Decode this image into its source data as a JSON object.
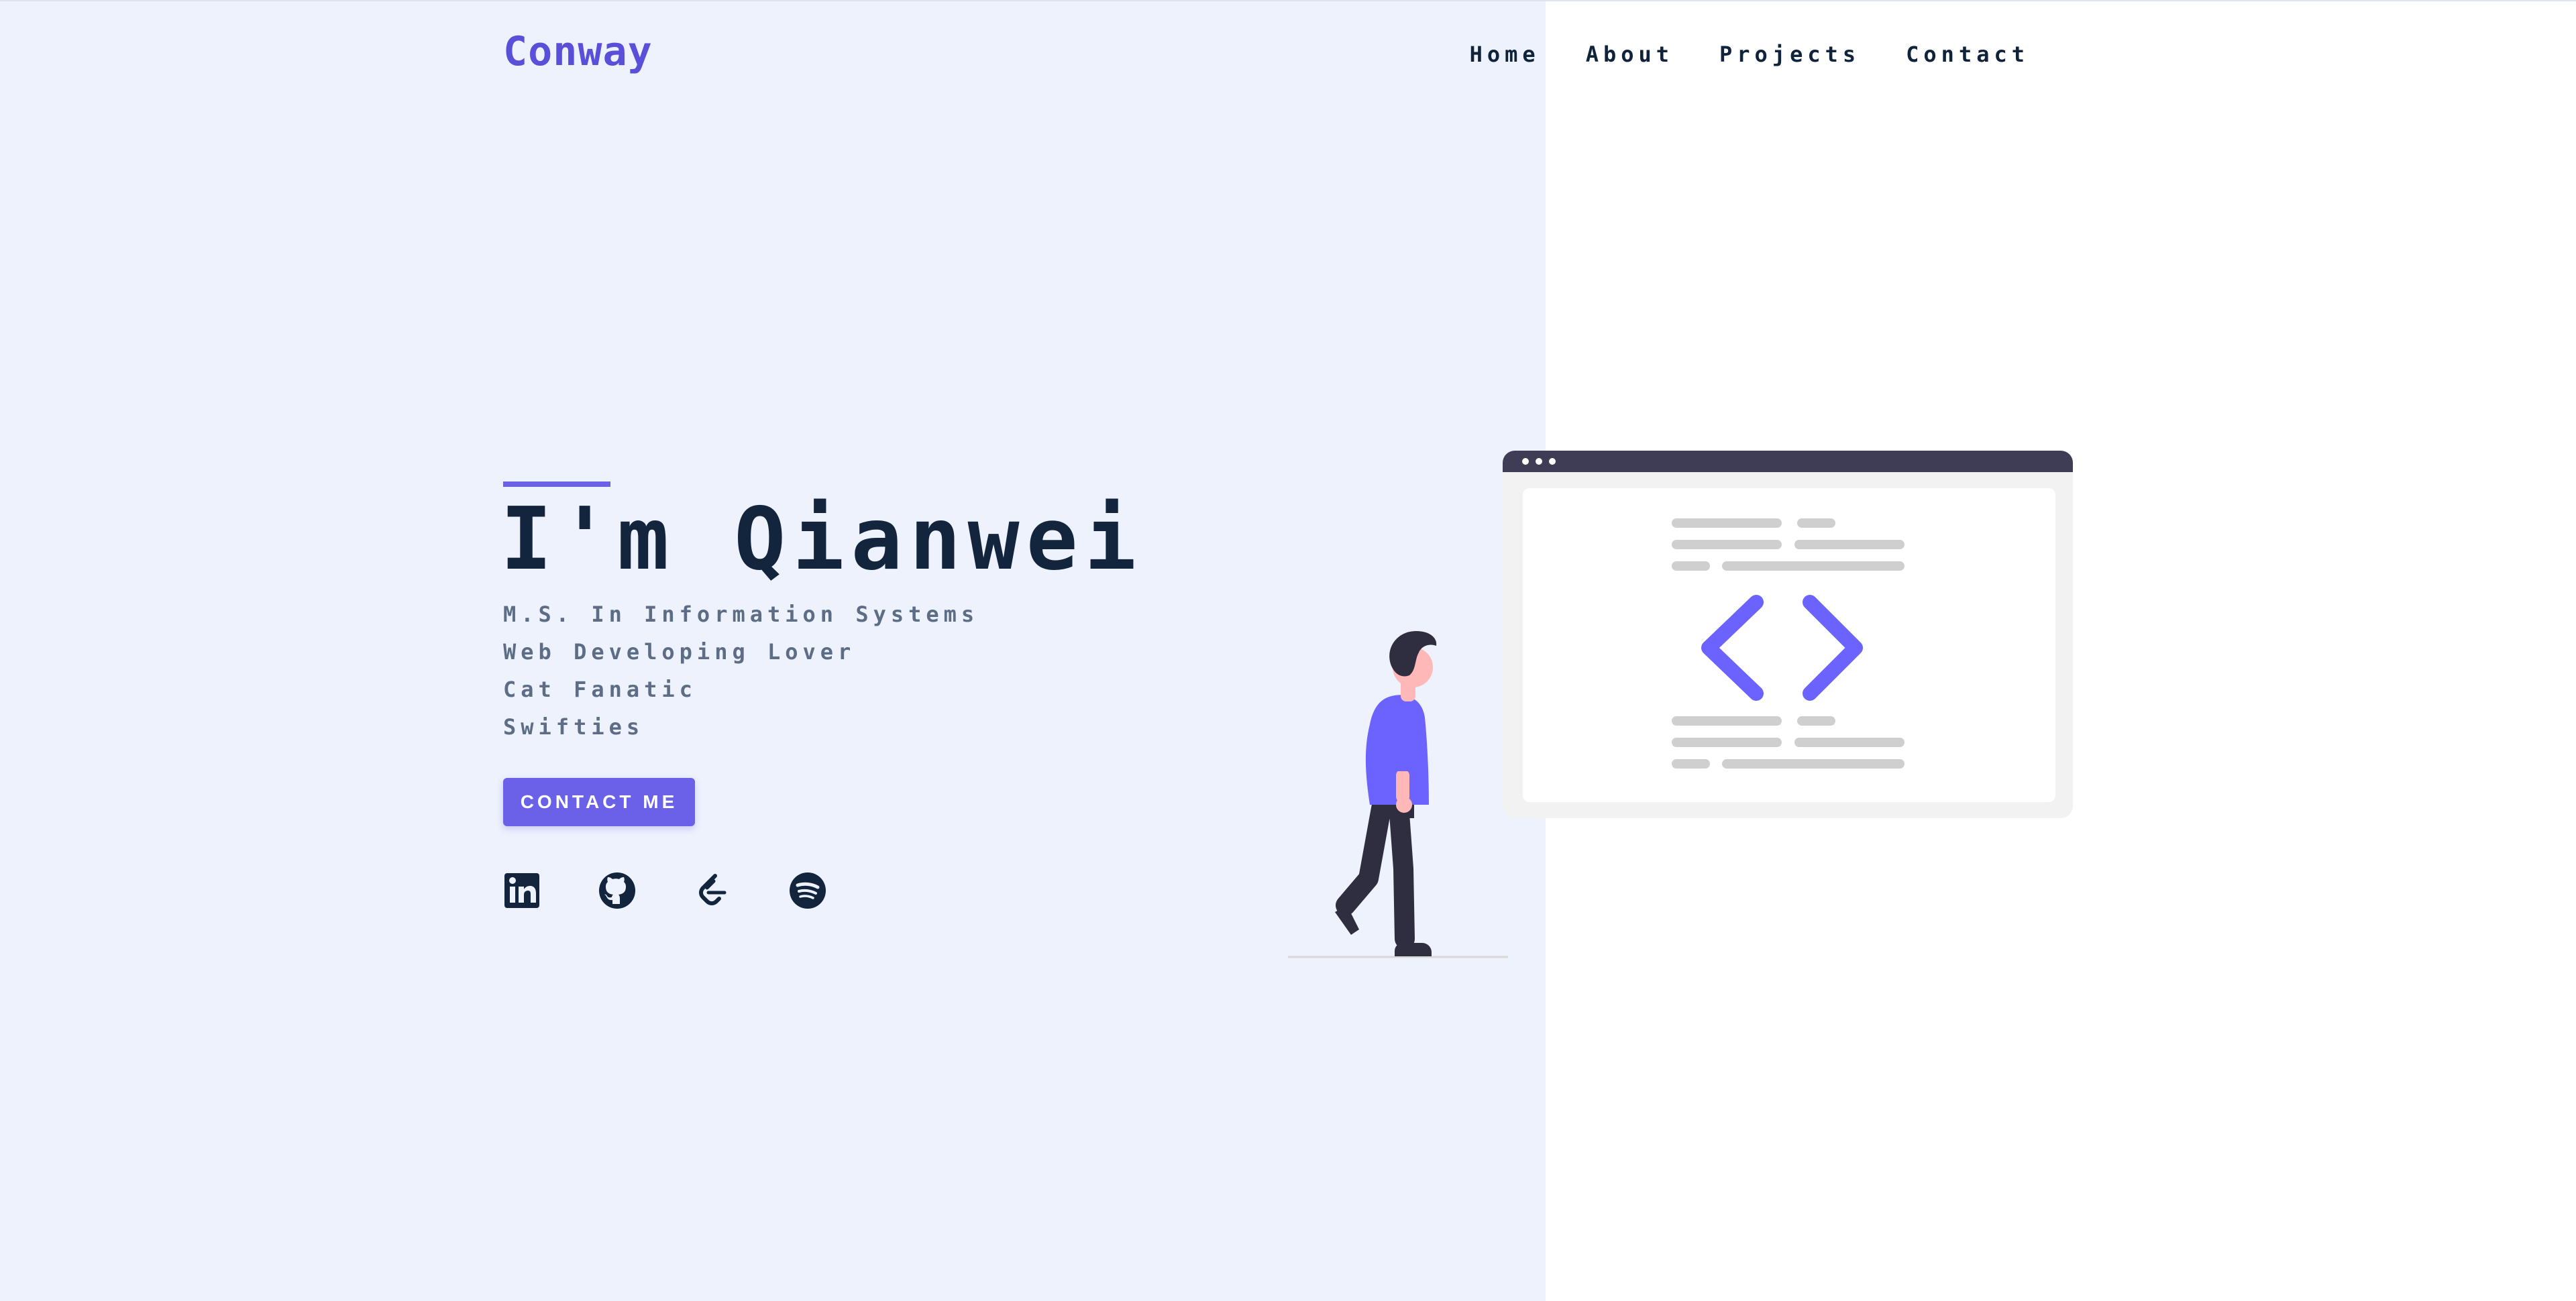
{
  "header": {
    "logo": "Conway",
    "nav": [
      "Home",
      "About",
      "Projects",
      "Contact"
    ]
  },
  "hero": {
    "title": "I'm Qianwei",
    "taglines": [
      "M.S. In Information Systems",
      "Web Developing Lover",
      "Cat Fanatic",
      "Swifties"
    ],
    "cta_label": "CONTACT ME"
  },
  "socials": [
    {
      "icon": "linkedin-icon"
    },
    {
      "icon": "github-icon"
    },
    {
      "icon": "leetcode-icon"
    },
    {
      "icon": "spotify-icon"
    }
  ],
  "colors": {
    "accent": "#6a61e8",
    "logo": "#5a4fd8",
    "heading": "#12253d",
    "subtext": "#5d6d85",
    "left_background": "#eef2fd",
    "right_background": "#ffffff"
  }
}
